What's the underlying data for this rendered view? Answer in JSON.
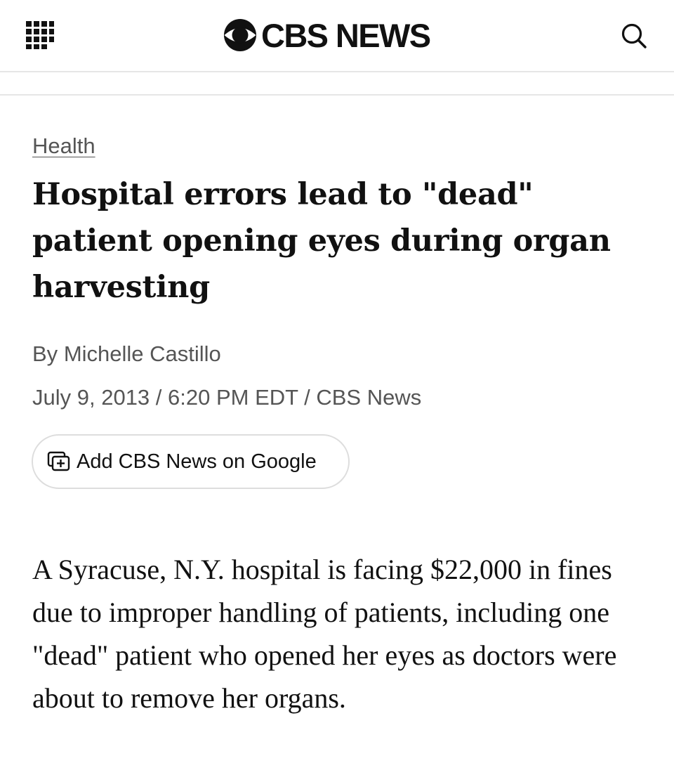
{
  "header": {
    "menu_icon": "grid-menu-icon",
    "logo_text": "CBS NEWS",
    "logo_icon": "cbs-eye-logo",
    "search_icon": "search-icon"
  },
  "article": {
    "category": "Health",
    "headline": "Hospital errors lead to \"dead\" patient opening eyes during organ harvesting",
    "byline_prefix": "By",
    "author": "Michelle Castillo",
    "dateline": "July 9, 2013 / 6:20 PM EDT / CBS News",
    "google_button_label": "Add CBS News on Google",
    "google_button_icon": "add-source-icon",
    "body": "A Syracuse, N.Y. hospital is facing $22,000 in fines due to improper handling of patients, including one \"dead\" patient who opened her eyes as doctors were about to remove her organs."
  },
  "colors": {
    "text": "#111111",
    "meta_text": "#555555",
    "divider": "#e6e6e6",
    "button_border": "#dddddd",
    "background": "#ffffff"
  }
}
